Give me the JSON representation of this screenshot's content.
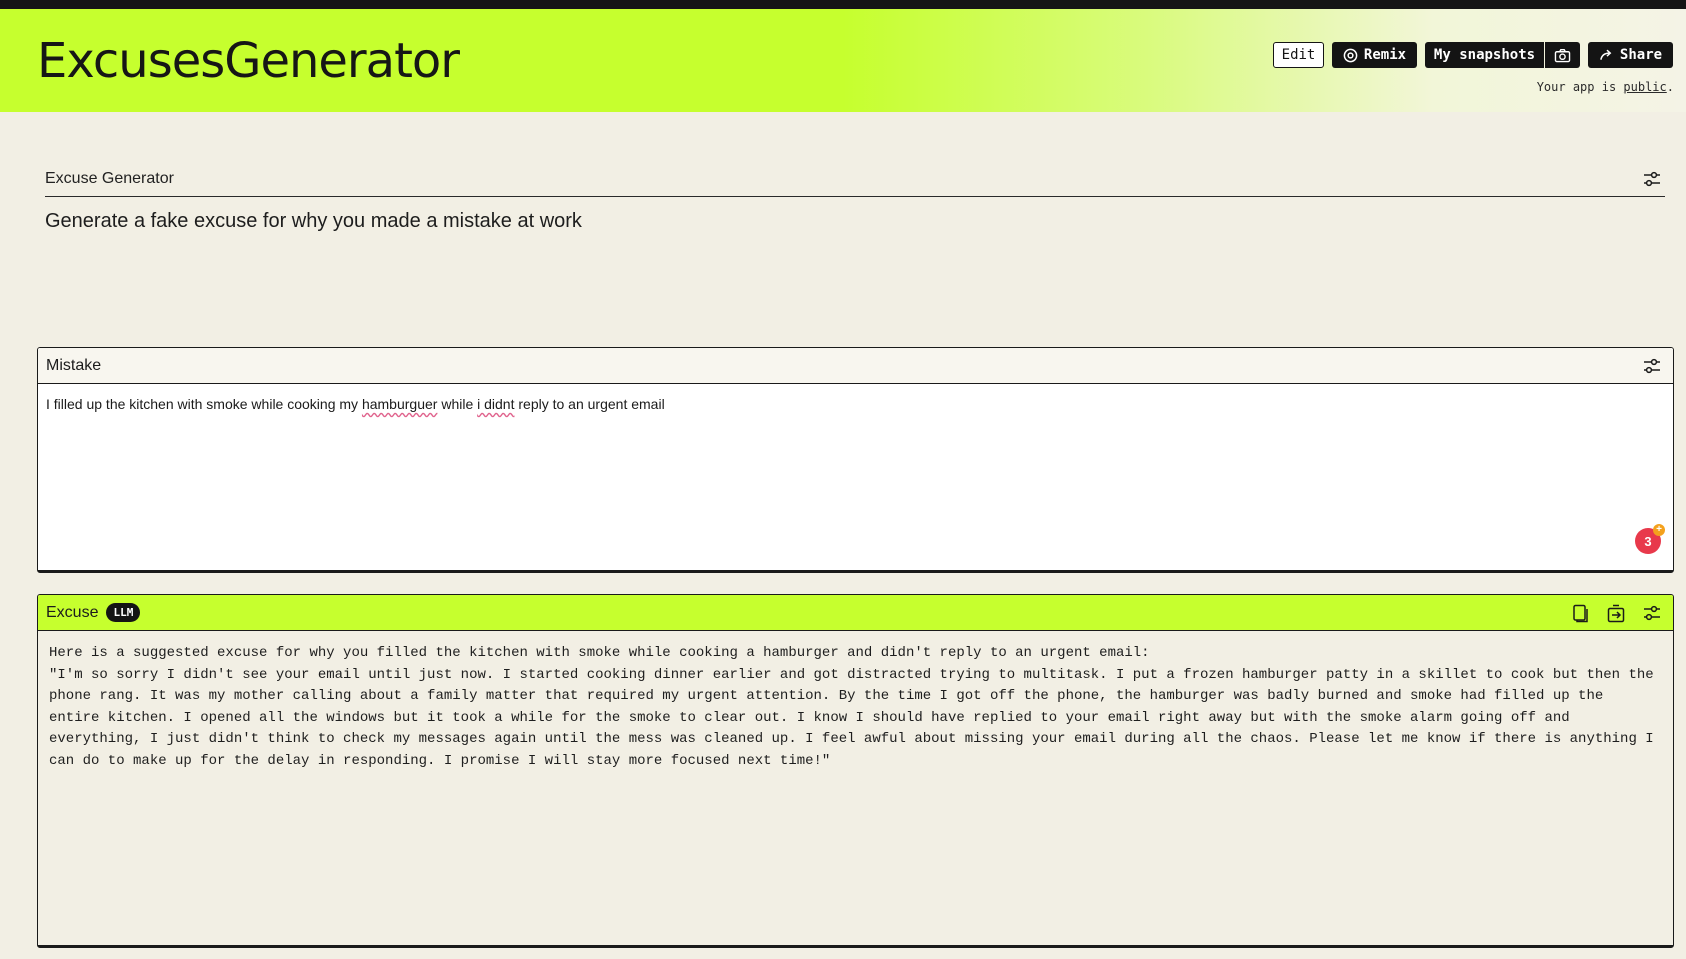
{
  "header": {
    "app_title": "ExcusesGenerator",
    "edit_label": "Edit",
    "remix_label": "Remix",
    "snapshots_label": "My snapshots",
    "share_label": "Share",
    "public_prefix": "Your app is ",
    "public_link": "public",
    "public_suffix": ".",
    "accent_color": "#c6ff2e"
  },
  "generator": {
    "title": "Excuse Generator",
    "description": "Generate a fake excuse for why you made a mistake at work"
  },
  "mistake": {
    "title": "Mistake",
    "text_before": "I filled up the kitchen with smoke while cooking my ",
    "spell_1": "hamburguer",
    "text_mid": " while ",
    "spell_2": "i didnt",
    "text_after": " reply to an urgent email",
    "badge_count": "3",
    "badge_plus": "+"
  },
  "excuse": {
    "title": "Excuse",
    "badge": "LLM",
    "output": "Here is a suggested excuse for why you filled the kitchen with smoke while cooking a hamburger and didn't reply to an urgent email:\n\"I'm so sorry I didn't see your email until just now. I started cooking dinner earlier and got distracted trying to multitask. I put a frozen hamburger patty in a skillet to cook but then the phone rang. It was my mother calling about a family matter that required my urgent attention. By the time I got off the phone, the hamburger was badly burned and smoke had filled up the entire kitchen. I opened all the windows but it took a while for the smoke to clear out. I know I should have replied to your email right away but with the smoke alarm going off and everything, I just didn't think to check my messages again until the mess was cleaned up. I feel awful about missing your email during all the chaos. Please let me know if there is anything I can do to make up for the delay in responding. I promise I will stay more focused next time!\""
  },
  "icons": {
    "remix": "remix-icon",
    "camera": "camera-icon",
    "share": "share-arrow-icon",
    "settings": "sliders-icon",
    "copy": "copy-icon",
    "export": "export-icon"
  }
}
